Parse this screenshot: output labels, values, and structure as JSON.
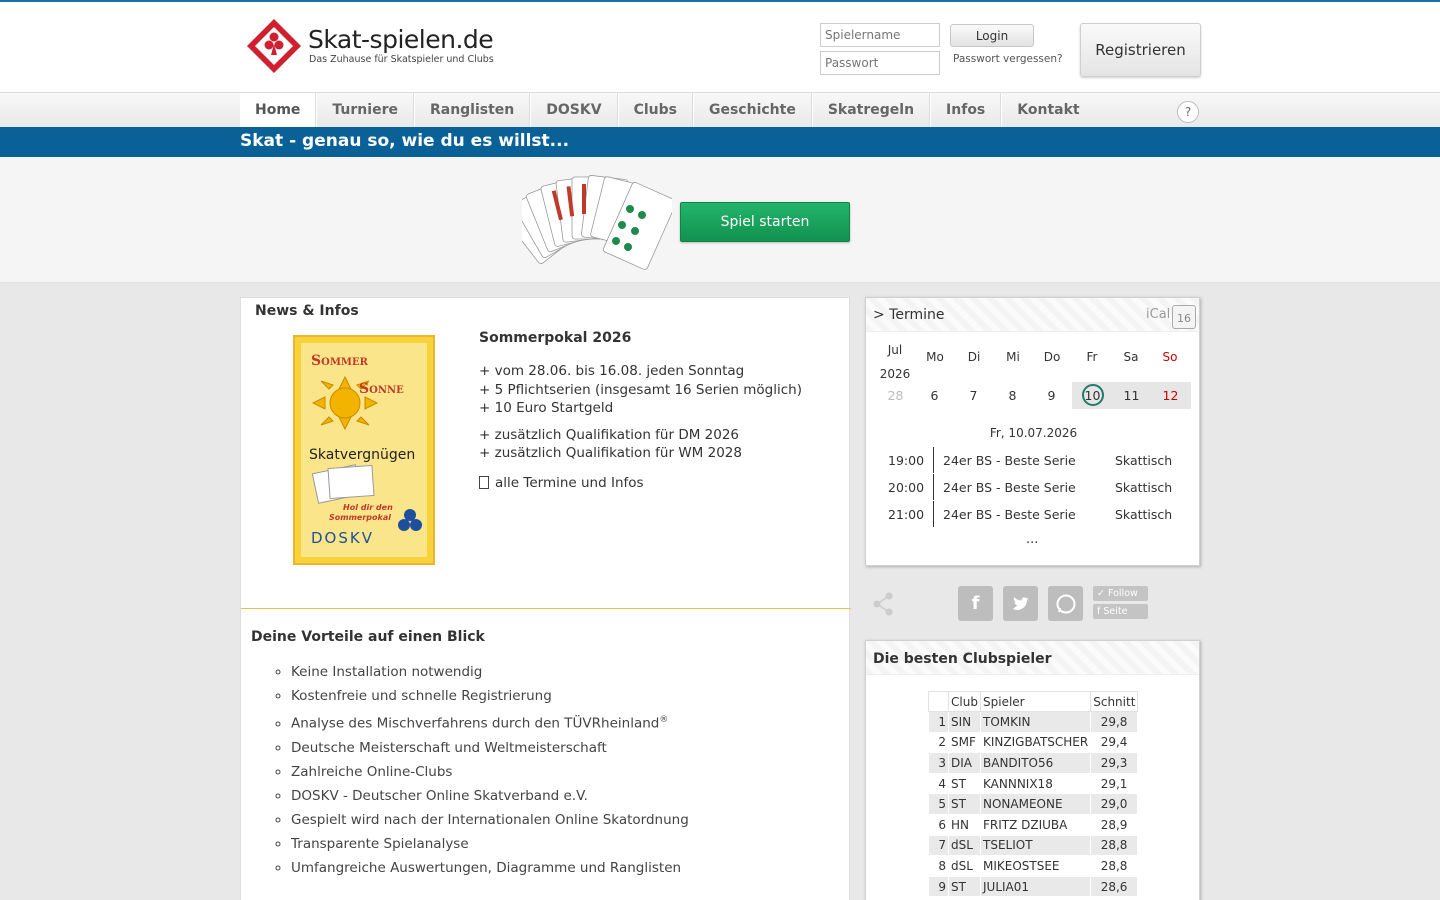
{
  "header": {
    "brand": "Skat-spielen.de",
    "tagline": "Das Zuhause für Skatspieler und Clubs",
    "username_placeholder": "Spielername",
    "password_placeholder": "Passwort",
    "login_label": "Login",
    "forgot_label": "Passwort vergessen?",
    "register_label": "Registrieren"
  },
  "nav": {
    "items": [
      "Home",
      "Turniere",
      "Ranglisten",
      "DOSKV",
      "Clubs",
      "Geschichte",
      "Skatregeln",
      "Infos",
      "Kontakt"
    ],
    "help": "?"
  },
  "banner": {
    "text": "Skat - genau so, wie du es willst..."
  },
  "hero": {
    "start_label": "Spiel starten"
  },
  "news": {
    "title": "News & Infos",
    "poster": {
      "line1": "Sommer",
      "line2": "Sonne",
      "line3": "Skatvergnügen",
      "line4": "Hol dir den",
      "line5": "Sommerpokal",
      "org": "DOSKV"
    },
    "headline": "Sommerpokal 2026",
    "lines": [
      "+ vom 28.06. bis 16.08. jeden Sonntag",
      "+ 5 Pflichtserien (insgesamt 16 Serien möglich)",
      "+ 10 Euro Startgeld",
      "+ zusätzlich Qualifikation für DM 2026",
      "+ zusätzlich Qualifikation für WM 2028"
    ],
    "all_link": "alle Termine und Infos"
  },
  "benefits": {
    "title": "Deine Vorteile auf einen Blick",
    "items": [
      "Keine Installation notwendig",
      "Kostenfreie und schnelle Registrierung",
      "Analyse des Mischverfahrens durch den TÜVRheinland",
      "Deutsche Meisterschaft und Weltmeisterschaft",
      "Zahlreiche Online-Clubs",
      "DOSKV - Deutscher Online Skatverband e.V.",
      "Gespielt wird nach der Internationalen Online Skatordnung",
      "Transparente Spielanalyse",
      "Umfangreiche Auswertungen, Diagramme und Ranglisten"
    ],
    "reg_mark": "®"
  },
  "termine": {
    "title": "> Termine",
    "ical": "iCal",
    "ical_num": "16",
    "month": "Jul",
    "year": "2026",
    "weekdays": [
      "Mo",
      "Di",
      "Mi",
      "Do",
      "Fr",
      "Sa",
      "So"
    ],
    "days": [
      "28",
      "6",
      "7",
      "8",
      "9",
      "10",
      "11",
      "12"
    ],
    "date_label": "Fr, 10.07.2026",
    "events": [
      {
        "time": "19:00",
        "name": "24er BS - Beste Serie",
        "loc": "Skattisch"
      },
      {
        "time": "20:00",
        "name": "24er BS - Beste Serie",
        "loc": "Skattisch"
      },
      {
        "time": "21:00",
        "name": "24er BS - Beste Serie",
        "loc": "Skattisch"
      }
    ],
    "more": "...",
    "colors": {
      "sunday": "#cc0000",
      "today_ring": "#1f7c6a"
    }
  },
  "social": {
    "follow": "Follow",
    "seite": "Seite"
  },
  "best": {
    "title": "Die besten Clubspieler",
    "headers": [
      "",
      "Club",
      "Spieler",
      "Schnitt"
    ],
    "rows": [
      [
        "1",
        "SIN",
        "TOMKIN",
        "29,8"
      ],
      [
        "2",
        "SMF",
        "KINZIGBATSCHER",
        "29,4"
      ],
      [
        "3",
        "DIA",
        "BANDITO56",
        "29,3"
      ],
      [
        "4",
        "ST",
        "KANNNIX18",
        "29,1"
      ],
      [
        "5",
        "ST",
        "NONAMEONE",
        "29,0"
      ],
      [
        "6",
        "HN",
        "FRITZ DZIUBA",
        "28,9"
      ],
      [
        "7",
        "dSL",
        "TSELIOT",
        "28,8"
      ],
      [
        "8",
        "dSL",
        "MIKEOSTSEE",
        "28,8"
      ],
      [
        "9",
        "ST",
        "JULIA01",
        "28,6"
      ]
    ]
  },
  "colors": {
    "accent": "#0a6197",
    "start_green": "#16a05c",
    "logo_red": "#d0202e"
  }
}
